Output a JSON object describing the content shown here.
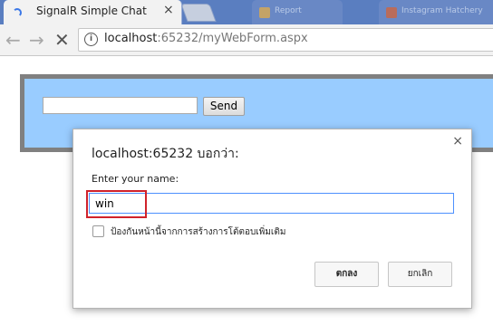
{
  "browser": {
    "active_tab": {
      "title": "SignalR Simple Chat",
      "close_glyph": "×"
    },
    "background_tabs": [
      {
        "label": "Report",
        "favicon_color": "#e8b04a"
      },
      {
        "label": "Instagram Hatchery",
        "favicon_color": "#d9663a"
      }
    ],
    "address": {
      "host": "localhost",
      "port": ":65232",
      "path": "/myWebForm.aspx"
    },
    "nav": {
      "back": "←",
      "forward": "→",
      "reload": "✕",
      "info": "i"
    }
  },
  "page": {
    "send_label": "Send",
    "message_value": "",
    "panel_color": "#99ccff"
  },
  "dialog": {
    "title": "localhost:65232 บอกว่า:",
    "prompt": "Enter your name:",
    "input_value": "win",
    "checkbox_label": "ป้องกันหน้านี้จากการสร้างการโต้ตอบเพิ่มเติม",
    "ok_label": "ตกลง",
    "cancel_label": "ยกเลิก",
    "close_glyph": "×",
    "highlight_color": "#d0222b"
  }
}
